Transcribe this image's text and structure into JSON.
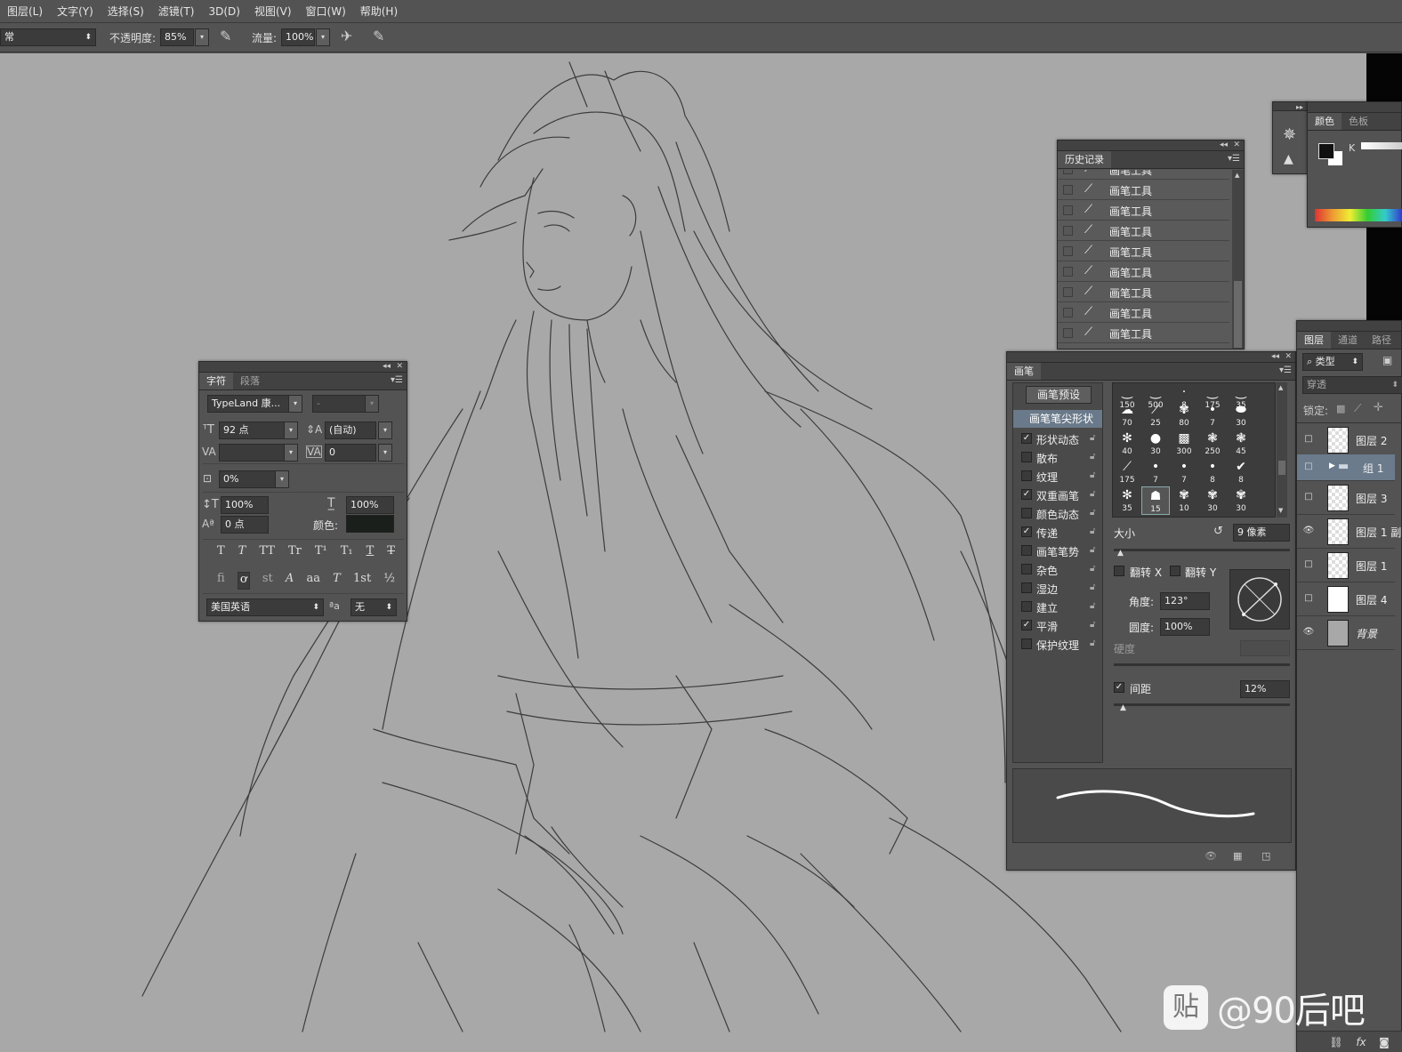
{
  "menubar": {
    "items": [
      "图层(L)",
      "文字(Y)",
      "选择(S)",
      "滤镜(T)",
      "3D(D)",
      "视图(V)",
      "窗口(W)",
      "帮助(H)"
    ]
  },
  "options": {
    "mode_value": "常",
    "opacity_label": "不透明度:",
    "opacity_value": "85%",
    "flow_label": "流量:",
    "flow_value": "100%"
  },
  "history": {
    "tab": "历史记录",
    "items": [
      "画笔工具",
      "画笔工具",
      "画笔工具",
      "画笔工具",
      "画笔工具",
      "画笔工具",
      "画笔工具",
      "画笔工具",
      "画笔工具"
    ]
  },
  "color": {
    "tabs": [
      "颜色",
      "色板"
    ],
    "channel_label": "K"
  },
  "character": {
    "tabs": [
      "字符",
      "段落"
    ],
    "font_family": "TypeLand 康...",
    "font_style": "-",
    "size": "92 点",
    "leading": "(自动)",
    "kerning": "",
    "tracking": "0",
    "scale_pct": "0%",
    "vscale": "100%",
    "hscale": "100%",
    "baseline": "0 点",
    "color_label": "颜色:",
    "language": "美国英语",
    "antialias": "无",
    "style_buttons": [
      "T",
      "T",
      "TT",
      "Tr",
      "T¹",
      "T₁",
      "T",
      "T"
    ],
    "opentype_buttons": [
      "fi",
      "ơ",
      "st",
      "A",
      "aa",
      "T",
      "1st",
      "½"
    ],
    "aa_icon": "ªa"
  },
  "brush": {
    "tab": "画笔",
    "preset_button": "画笔预设",
    "tip_shape": "画笔笔尖形状",
    "options": [
      {
        "label": "形状动态",
        "checked": true
      },
      {
        "label": "散布",
        "checked": false
      },
      {
        "label": "纹理",
        "checked": false
      },
      {
        "label": "双重画笔",
        "checked": true
      },
      {
        "label": "颜色动态",
        "checked": false
      },
      {
        "label": "传递",
        "checked": true
      },
      {
        "label": "画笔笔势",
        "checked": false
      },
      {
        "label": "杂色",
        "checked": false
      },
      {
        "label": "湿边",
        "checked": false
      },
      {
        "label": "建立",
        "checked": false
      },
      {
        "label": "平滑",
        "checked": true
      },
      {
        "label": "保护纹理",
        "checked": false
      }
    ],
    "tip_sizes": [
      "150",
      "500",
      "8",
      "175",
      "35",
      "70",
      "25",
      "80",
      "7",
      "30",
      "40",
      "30",
      "300",
      "250",
      "45",
      "175",
      "7",
      "7",
      "8",
      "8",
      "35",
      "15",
      "10",
      "30",
      "30"
    ],
    "size_label": "大小",
    "size_value": "9 像素",
    "flip_x": "翻转 X",
    "flip_y": "翻转 Y",
    "angle_label": "角度:",
    "angle_value": "123°",
    "roundness_label": "圆度:",
    "roundness_value": "100%",
    "hardness_label": "硬度",
    "spacing_label": "间距",
    "spacing_value": "12%"
  },
  "layers": {
    "tabs": [
      "图层",
      "通道",
      "路径"
    ],
    "filter_kind": "类型",
    "blend_mode": "穿透",
    "lock_label": "锁定:",
    "items": [
      {
        "name": "图层 2",
        "visible": false
      },
      {
        "name": "组 1",
        "visible": false
      },
      {
        "name": "图层 3",
        "visible": false
      },
      {
        "name": "图层 1 副",
        "visible": true
      },
      {
        "name": "图层 1",
        "visible": false
      },
      {
        "name": "图层 4",
        "visible": false
      },
      {
        "name": "背景",
        "visible": true
      }
    ]
  },
  "watermark": {
    "text": "@90后吧",
    "badge": "贴"
  }
}
